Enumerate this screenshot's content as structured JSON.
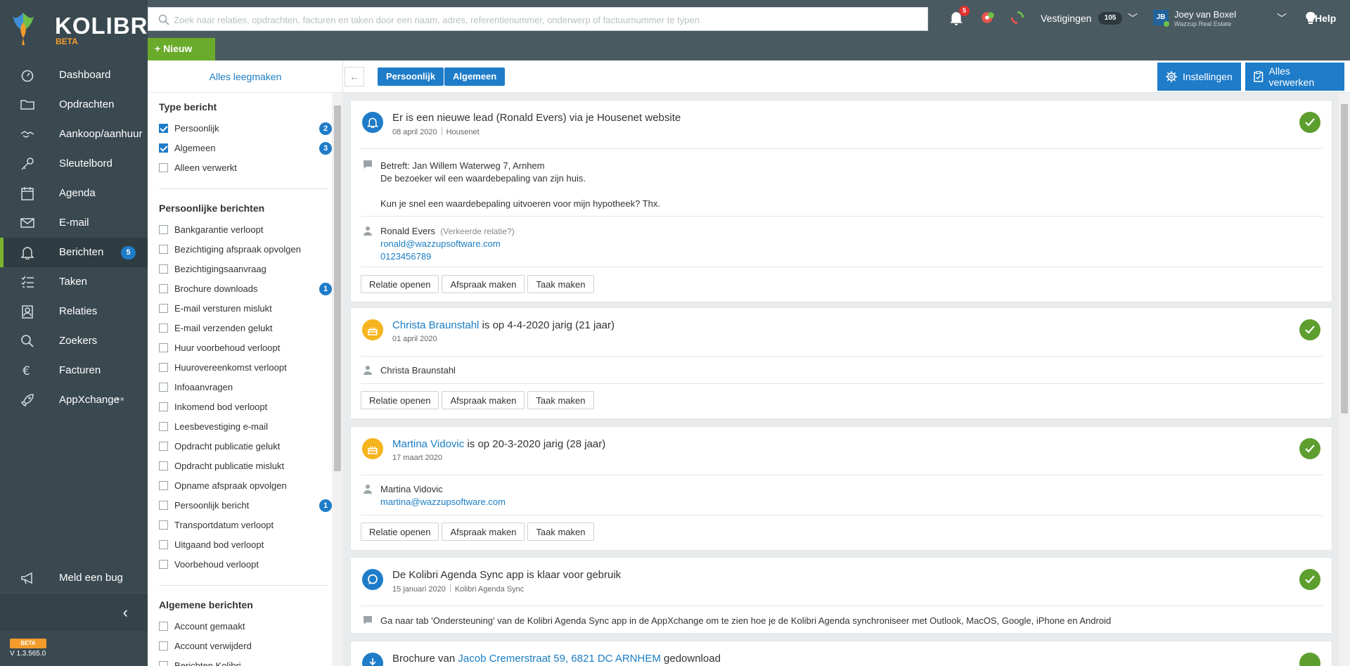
{
  "app": {
    "brand": "KOLIBRI",
    "brand_tag": "BETA",
    "version": "V 1.3.565.0",
    "beta_label": "BETA"
  },
  "sidebar": {
    "items": [
      {
        "label": "Dashboard",
        "icon": "dashboard-icon"
      },
      {
        "label": "Opdrachten",
        "icon": "folder-icon"
      },
      {
        "label": "Aankoop/aanhuur",
        "icon": "handshake-icon"
      },
      {
        "label": "Sleutelbord",
        "icon": "key-icon"
      },
      {
        "label": "Agenda",
        "icon": "calendar-icon"
      },
      {
        "label": "E-mail",
        "icon": "envelope-icon"
      },
      {
        "label": "Berichten",
        "icon": "bell-icon",
        "badge": "5",
        "active": true
      },
      {
        "label": "Taken",
        "icon": "tasks-icon"
      },
      {
        "label": "Relaties",
        "icon": "contacts-icon"
      },
      {
        "label": "Zoekers",
        "icon": "search-icon"
      },
      {
        "label": "Facturen",
        "icon": "euro-icon"
      },
      {
        "label": "AppXchange",
        "icon": "rocket-icon"
      }
    ],
    "bug_label": "Meld een bug"
  },
  "topbar": {
    "search_placeholder": "Zoek naar relaties, opdrachten, facturen en taken door een naam, adres, referentienummer, onderwerp of factuurnummer te typen",
    "new_label": "+ Nieuw",
    "notification_count": "5",
    "vestigingen_label": "Vestigingen",
    "vestigingen_count": "105",
    "user_initials": "JB",
    "user_name": "Joey van Boxel",
    "user_company": "Wazzup Real Estate",
    "help_label": "Help"
  },
  "filters": {
    "clear_label": "Alles leegmaken",
    "type_heading": "Type bericht",
    "type_items": [
      {
        "label": "Persoonlijk",
        "checked": true,
        "badge": "2"
      },
      {
        "label": "Algemeen",
        "checked": true,
        "badge": "3"
      },
      {
        "label": "Alleen verwerkt",
        "checked": false
      }
    ],
    "personal_heading": "Persoonlijke berichten",
    "personal_items": [
      {
        "label": "Bankgarantie verloopt"
      },
      {
        "label": "Bezichtiging afspraak opvolgen"
      },
      {
        "label": "Bezichtigingsaanvraag"
      },
      {
        "label": "Brochure downloads",
        "badge": "1"
      },
      {
        "label": "E-mail versturen mislukt"
      },
      {
        "label": "E-mail verzenden gelukt"
      },
      {
        "label": "Huur voorbehoud verloopt"
      },
      {
        "label": "Huurovereenkomst verloopt"
      },
      {
        "label": "Infoaanvragen"
      },
      {
        "label": "Inkomend bod verloopt"
      },
      {
        "label": "Leesbevestiging e-mail"
      },
      {
        "label": "Opdracht publicatie gelukt"
      },
      {
        "label": "Opdracht publicatie mislukt"
      },
      {
        "label": "Opname afspraak opvolgen"
      },
      {
        "label": "Persoonlijk bericht",
        "badge": "1"
      },
      {
        "label": "Transportdatum verloopt"
      },
      {
        "label": "Uitgaand bod verloopt"
      },
      {
        "label": "Voorbehoud verloopt"
      }
    ],
    "general_heading": "Algemene berichten",
    "general_items": [
      {
        "label": "Account gemaakt"
      },
      {
        "label": "Account verwijderd"
      },
      {
        "label": "Berichten Kolibri"
      }
    ]
  },
  "toolbar": {
    "chips": [
      "Persoonlijk",
      "Algemeen"
    ],
    "settings_label": "Instellingen",
    "process_all_label": "Alles verwerken"
  },
  "messages": [
    {
      "title": "Er is een nieuwe lead (Ronald Evers) via je Housenet website",
      "date": "08 april 2020",
      "source": "Housenet",
      "body_lines": [
        "Betreft: Jan Willem Waterweg 7, Arnhem",
        "De bezoeker wil een waardebepaling van zijn huis.",
        "",
        "Kun je snel een waardebepaling uitvoeren voor mijn hypotheek? Thx."
      ],
      "contact_name": "Ronald Evers",
      "contact_note": "(Verkeerde relatie?)",
      "contact_email": "ronald@wazzupsoftware.com",
      "contact_phone": "0123456789",
      "actions": [
        "Relatie openen",
        "Afspraak maken",
        "Taak maken"
      ]
    },
    {
      "title_link": "Christa Braunstahl",
      "title_rest": " is op 4-4-2020 jarig (21 jaar)",
      "date": "01 april 2020",
      "contact_name": "Christa Braunstahl",
      "actions": [
        "Relatie openen",
        "Afspraak maken",
        "Taak maken"
      ]
    },
    {
      "title_link": "Martina Vidovic",
      "title_rest": " is op 20-3-2020 jarig (28 jaar)",
      "date": "17 maart 2020",
      "contact_name": "Martina Vidovic",
      "contact_email": "martina@wazzupsoftware.com",
      "actions": [
        "Relatie openen",
        "Afspraak maken",
        "Taak maken"
      ]
    },
    {
      "title": "De Kolibri Agenda Sync app is klaar voor gebruik",
      "date": "15 januari 2020",
      "source": "Kolibri Agenda Sync",
      "body": "Ga naar tab 'Ondersteuning' van de Kolibri Agenda Sync app in de AppXchange om te zien hoe je de Kolibri Agenda synchroniseer met Outlook, MacOS, Google, iPhone en Android"
    },
    {
      "title_prefix": "Brochure van ",
      "title_link": "Jacob Cremerstraat 59, 6821 DC ARNHEM",
      "title_rest": " gedownload"
    }
  ]
}
